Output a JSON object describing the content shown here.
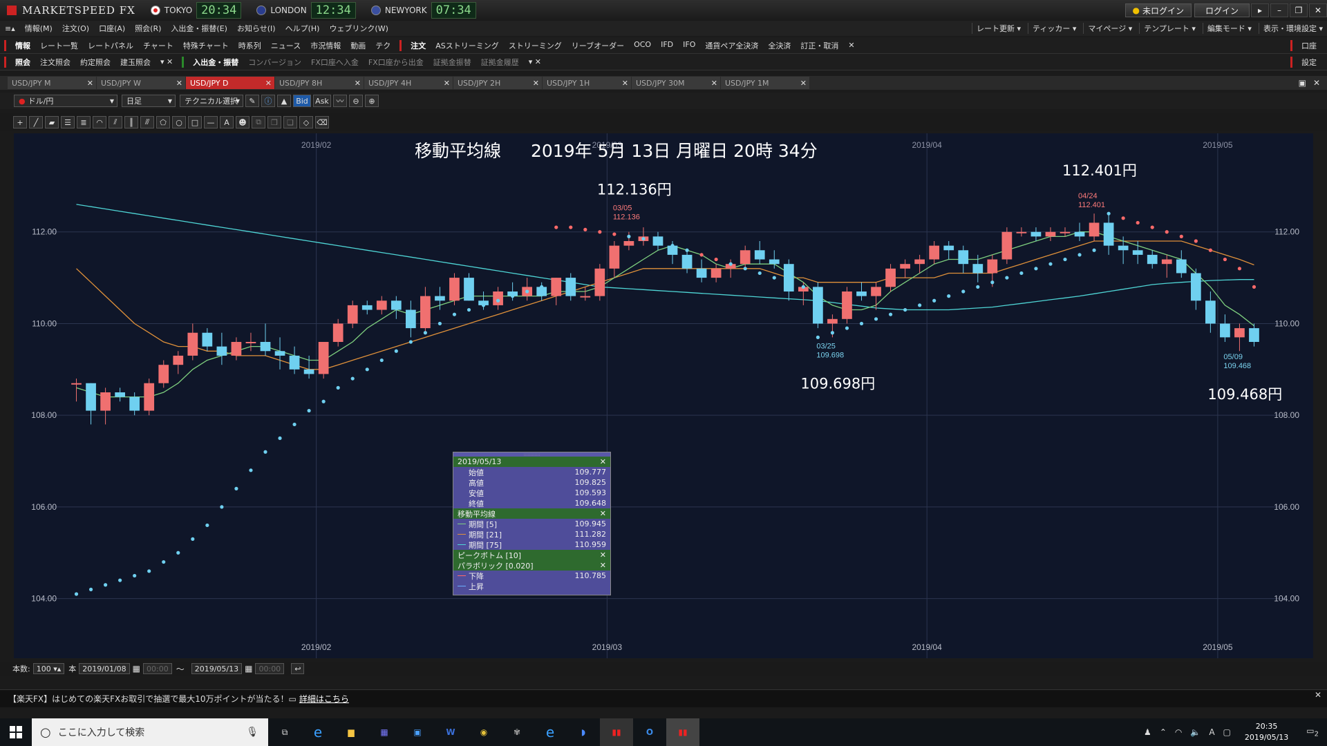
{
  "app": {
    "title": "MARKETSPEED FX"
  },
  "clocks": [
    {
      "city": "TOKYO",
      "time": "20:34",
      "flag": "#d22"
    },
    {
      "city": "LONDON",
      "time": "12:34",
      "flag": "#24a"
    },
    {
      "city": "NEWYORK",
      "time": "07:34",
      "flag": "#35a"
    }
  ],
  "titlebar": {
    "login_status": "未ログイン",
    "login": "ログイン"
  },
  "menu": [
    "情報(M)",
    "注文(O)",
    "口座(A)",
    "照会(R)",
    "入出金・振替(E)",
    "お知らせ(I)",
    "ヘルプ(H)",
    "ウェブリンク(W)"
  ],
  "menu_right": [
    "レート更新",
    "ティッカー",
    "マイページ",
    "テンプレート",
    "編集モード",
    "表示・環境設定"
  ],
  "toolbar1": {
    "left": [
      "情報",
      "レート一覧",
      "レートパネル",
      "チャート",
      "特殊チャート",
      "時系列",
      "ニュース",
      "市況情報",
      "動画",
      "テク"
    ],
    "right": [
      "注文",
      "ASストリーミング",
      "ストリーミング",
      "リーブオーダー",
      "OCO",
      "IFD",
      "IFO",
      "通貨ペア全決済",
      "全決済",
      "訂正・取消"
    ],
    "end": "口座"
  },
  "toolbar2": {
    "left": [
      "照会",
      "注文照会",
      "約定照会",
      "建玉照会"
    ],
    "right": [
      "入出金・振替",
      "コンバージョン",
      "FX口座へ入金",
      "FX口座から出金",
      "証拠金振替",
      "証拠金履歴"
    ],
    "end": "設定"
  },
  "tabs": [
    "USD/JPY M",
    "USD/JPY W",
    "USD/JPY D",
    "USD/JPY 8H",
    "USD/JPY 4H",
    "USD/JPY 2H",
    "USD/JPY 1H",
    "USD/JPY 30M",
    "USD/JPY 1M"
  ],
  "active_tab": 2,
  "controls": {
    "pair": "ドル/円",
    "timeframe": "日足",
    "technical": "テクニカル選択",
    "bid": "Bid",
    "ask": "Ask"
  },
  "chart_data": {
    "type": "candlestick",
    "title": "移動平均線",
    "datetime": "2019年 5月 13日 月曜日 20時 34分",
    "ylim": [
      103.0,
      114.0
    ],
    "yticks": [
      104.0,
      106.0,
      108.0,
      110.0,
      112.0
    ],
    "month_labels": [
      "2019/02",
      "2019/03",
      "2019/04",
      "2019/05"
    ],
    "callouts": [
      {
        "date": "03/05",
        "value": "112.136",
        "label": "112.136円",
        "kind": "high"
      },
      {
        "date": "03/25",
        "value": "109.698",
        "label": "109.698円",
        "kind": "low"
      },
      {
        "date": "04/24",
        "value": "112.401",
        "label": "112.401円",
        "kind": "high"
      },
      {
        "date": "05/09",
        "value": "109.468",
        "label": "109.468円",
        "kind": "low"
      }
    ],
    "ohlc": [
      [
        108.7,
        108.8,
        108.3,
        108.7
      ],
      [
        108.7,
        108.7,
        107.8,
        108.1
      ],
      [
        108.1,
        108.6,
        107.8,
        108.5
      ],
      [
        108.5,
        108.6,
        108.3,
        108.4
      ],
      [
        108.4,
        108.5,
        108.0,
        108.1
      ],
      [
        108.1,
        108.8,
        108.0,
        108.7
      ],
      [
        108.7,
        109.2,
        108.6,
        109.1
      ],
      [
        109.1,
        109.4,
        108.9,
        109.3
      ],
      [
        109.3,
        110.0,
        109.2,
        109.8
      ],
      [
        109.8,
        109.9,
        109.4,
        109.5
      ],
      [
        109.5,
        109.8,
        109.1,
        109.3
      ],
      [
        109.3,
        109.7,
        109.2,
        109.6
      ],
      [
        109.6,
        109.8,
        109.4,
        109.6
      ],
      [
        109.6,
        110.0,
        109.3,
        109.4
      ],
      [
        109.4,
        109.7,
        109.0,
        109.3
      ],
      [
        109.3,
        109.5,
        108.9,
        109.0
      ],
      [
        109.0,
        109.3,
        108.8,
        108.9
      ],
      [
        108.9,
        109.6,
        108.8,
        109.6
      ],
      [
        109.6,
        110.1,
        109.5,
        110.0
      ],
      [
        110.0,
        110.5,
        109.9,
        110.4
      ],
      [
        110.4,
        110.5,
        110.2,
        110.3
      ],
      [
        110.3,
        110.6,
        110.2,
        110.5
      ],
      [
        110.5,
        110.6,
        110.1,
        110.3
      ],
      [
        110.3,
        110.5,
        109.7,
        109.9
      ],
      [
        109.9,
        110.8,
        109.8,
        110.6
      ],
      [
        110.6,
        110.8,
        110.3,
        110.5
      ],
      [
        110.5,
        111.1,
        110.4,
        111.0
      ],
      [
        111.0,
        111.1,
        110.5,
        110.5
      ],
      [
        110.5,
        110.7,
        110.3,
        110.4
      ],
      [
        110.4,
        110.8,
        110.3,
        110.7
      ],
      [
        110.7,
        110.9,
        110.5,
        110.6
      ],
      [
        110.6,
        111.0,
        110.5,
        110.8
      ],
      [
        110.8,
        110.9,
        110.5,
        110.6
      ],
      [
        110.6,
        111.0,
        110.4,
        111.0
      ],
      [
        111.0,
        111.1,
        110.5,
        110.6
      ],
      [
        110.6,
        110.8,
        110.5,
        110.6
      ],
      [
        110.6,
        111.3,
        110.5,
        111.2
      ],
      [
        111.2,
        111.8,
        111.0,
        111.7
      ],
      [
        111.7,
        112.0,
        111.6,
        111.8
      ],
      [
        111.8,
        112.1,
        111.7,
        111.9
      ],
      [
        111.9,
        112.0,
        111.6,
        111.7
      ],
      [
        111.7,
        111.8,
        111.3,
        111.5
      ],
      [
        111.5,
        111.6,
        111.1,
        111.2
      ],
      [
        111.2,
        111.4,
        110.9,
        111.0
      ],
      [
        111.0,
        111.3,
        110.9,
        111.2
      ],
      [
        111.2,
        111.4,
        111.0,
        111.3
      ],
      [
        111.3,
        111.7,
        111.2,
        111.6
      ],
      [
        111.6,
        111.8,
        111.3,
        111.4
      ],
      [
        111.4,
        111.6,
        111.2,
        111.3
      ],
      [
        111.3,
        111.4,
        110.5,
        110.7
      ],
      [
        110.7,
        110.9,
        110.4,
        110.8
      ],
      [
        110.8,
        110.9,
        109.9,
        110.0
      ],
      [
        110.0,
        110.2,
        109.7,
        110.1
      ],
      [
        110.1,
        110.8,
        110.0,
        110.7
      ],
      [
        110.7,
        110.9,
        110.5,
        110.6
      ],
      [
        110.6,
        110.9,
        110.3,
        110.8
      ],
      [
        110.8,
        111.3,
        110.7,
        111.2
      ],
      [
        111.2,
        111.4,
        111.0,
        111.3
      ],
      [
        111.3,
        111.5,
        111.1,
        111.4
      ],
      [
        111.4,
        111.8,
        111.3,
        111.7
      ],
      [
        111.7,
        111.8,
        111.4,
        111.6
      ],
      [
        111.6,
        111.7,
        111.1,
        111.3
      ],
      [
        111.3,
        111.5,
        110.9,
        111.1
      ],
      [
        111.1,
        111.5,
        110.8,
        111.4
      ],
      [
        111.4,
        112.1,
        111.3,
        112.0
      ],
      [
        112.0,
        112.1,
        111.9,
        112.0
      ],
      [
        112.0,
        112.1,
        111.8,
        111.9
      ],
      [
        111.9,
        112.1,
        111.8,
        112.0
      ],
      [
        112.0,
        112.1,
        111.9,
        112.0
      ],
      [
        112.0,
        112.2,
        111.8,
        111.9
      ],
      [
        111.9,
        112.4,
        111.8,
        112.2
      ],
      [
        112.2,
        112.4,
        111.5,
        111.7
      ],
      [
        111.7,
        111.9,
        111.3,
        111.6
      ],
      [
        111.6,
        111.8,
        111.3,
        111.5
      ],
      [
        111.5,
        111.6,
        111.2,
        111.3
      ],
      [
        111.3,
        111.5,
        111.0,
        111.4
      ],
      [
        111.4,
        111.6,
        111.0,
        111.1
      ],
      [
        111.1,
        111.2,
        110.3,
        110.5
      ],
      [
        110.5,
        110.7,
        109.8,
        110.0
      ],
      [
        110.0,
        110.2,
        109.6,
        109.7
      ],
      [
        109.7,
        110.0,
        109.4,
        109.9
      ],
      [
        109.9,
        110.0,
        109.5,
        109.6
      ]
    ],
    "ma5": [
      108.6,
      108.5,
      108.4,
      108.4,
      108.4,
      108.4,
      108.5,
      108.7,
      109.0,
      109.2,
      109.3,
      109.4,
      109.5,
      109.5,
      109.4,
      109.3,
      109.2,
      109.2,
      109.4,
      109.6,
      109.9,
      110.1,
      110.3,
      110.2,
      110.3,
      110.4,
      110.5,
      110.6,
      110.6,
      110.6,
      110.6,
      110.6,
      110.6,
      110.7,
      110.7,
      110.7,
      110.8,
      111.0,
      111.2,
      111.4,
      111.6,
      111.7,
      111.6,
      111.5,
      111.3,
      111.2,
      111.3,
      111.3,
      111.3,
      111.1,
      110.9,
      110.6,
      110.4,
      110.3,
      110.3,
      110.4,
      110.7,
      110.9,
      111.1,
      111.3,
      111.4,
      111.4,
      111.4,
      111.5,
      111.6,
      111.7,
      111.8,
      111.9,
      111.9,
      112.0,
      112.0,
      111.9,
      111.8,
      111.7,
      111.6,
      111.5,
      111.4,
      111.1,
      110.8,
      110.4,
      110.2,
      109.95
    ],
    "ma21": [
      111.2,
      110.9,
      110.6,
      110.3,
      110.0,
      109.8,
      109.6,
      109.5,
      109.5,
      109.4,
      109.4,
      109.3,
      109.3,
      109.3,
      109.2,
      109.1,
      109.0,
      109.0,
      109.1,
      109.2,
      109.3,
      109.4,
      109.5,
      109.6,
      109.7,
      109.8,
      109.9,
      110.0,
      110.1,
      110.2,
      110.3,
      110.4,
      110.5,
      110.6,
      110.7,
      110.8,
      110.9,
      111.0,
      111.1,
      111.2,
      111.2,
      111.2,
      111.2,
      111.2,
      111.2,
      111.2,
      111.2,
      111.2,
      111.1,
      111.0,
      111.0,
      110.9,
      110.9,
      110.9,
      110.9,
      110.9,
      111.0,
      111.0,
      111.0,
      111.0,
      111.1,
      111.1,
      111.1,
      111.1,
      111.2,
      111.3,
      111.4,
      111.5,
      111.6,
      111.7,
      111.8,
      111.8,
      111.8,
      111.8,
      111.8,
      111.8,
      111.8,
      111.7,
      111.6,
      111.5,
      111.4,
      111.28
    ],
    "ma75": [
      112.6,
      112.55,
      112.5,
      112.45,
      112.4,
      112.35,
      112.3,
      112.25,
      112.2,
      112.15,
      112.1,
      112.05,
      112.0,
      111.95,
      111.9,
      111.85,
      111.8,
      111.75,
      111.7,
      111.65,
      111.6,
      111.55,
      111.5,
      111.45,
      111.4,
      111.35,
      111.3,
      111.25,
      111.2,
      111.15,
      111.1,
      111.05,
      111.0,
      110.95,
      110.9,
      110.85,
      110.8,
      110.78,
      110.76,
      110.74,
      110.72,
      110.7,
      110.68,
      110.66,
      110.64,
      110.62,
      110.6,
      110.58,
      110.56,
      110.54,
      110.52,
      110.5,
      110.46,
      110.42,
      110.38,
      110.34,
      110.32,
      110.3,
      110.3,
      110.3,
      110.3,
      110.32,
      110.34,
      110.36,
      110.4,
      110.44,
      110.48,
      110.52,
      110.56,
      110.6,
      110.65,
      110.7,
      110.75,
      110.8,
      110.85,
      110.88,
      110.9,
      110.92,
      110.94,
      110.95,
      110.96,
      110.96
    ],
    "sar": [
      104.1,
      104.2,
      104.3,
      104.4,
      104.5,
      104.6,
      104.8,
      105.0,
      105.3,
      105.6,
      106.0,
      106.4,
      106.8,
      107.2,
      107.5,
      107.8,
      108.1,
      108.3,
      108.6,
      108.8,
      109.0,
      109.2,
      109.4,
      109.6,
      109.8,
      110.0,
      110.2,
      110.3,
      110.4,
      110.5,
      110.6,
      110.7,
      110.8,
      112.1,
      112.1,
      112.05,
      112.0,
      111.95,
      111.9,
      111.85,
      111.8,
      111.7,
      111.6,
      111.5,
      111.4,
      111.3,
      111.2,
      111.1,
      111.0,
      110.9,
      110.8,
      109.7,
      109.8,
      109.9,
      110.0,
      110.1,
      110.2,
      110.3,
      110.4,
      110.5,
      110.6,
      110.7,
      110.8,
      110.9,
      111.0,
      111.1,
      111.2,
      111.3,
      111.4,
      111.5,
      111.6,
      112.4,
      112.3,
      112.2,
      112.1,
      112.0,
      111.9,
      111.8,
      111.6,
      111.4,
      111.2,
      110.8
    ]
  },
  "info_panel": {
    "date": "2019/05/13",
    "ohlc": [
      {
        "label": "始値",
        "value": "109.777"
      },
      {
        "label": "高値",
        "value": "109.825"
      },
      {
        "label": "安値",
        "value": "109.593"
      },
      {
        "label": "終値",
        "value": "109.648"
      }
    ],
    "ma_title": "移動平均線",
    "ma": [
      {
        "label": "期間 [5]",
        "value": "109.945",
        "color": "#7fd07f"
      },
      {
        "label": "期間 [21]",
        "value": "111.282",
        "color": "#e0913a"
      },
      {
        "label": "期間 [75]",
        "value": "110.959",
        "color": "#4fd6d6"
      }
    ],
    "peak": "ピークボトム [10]",
    "parabolic": "パラボリック [0.020]",
    "para": [
      {
        "label": "下降",
        "value": "110.785",
        "color": "#ff6a6a"
      },
      {
        "label": "上昇",
        "value": "",
        "color": "#6ab0ff"
      }
    ]
  },
  "bottom": {
    "count_label": "本数:",
    "count": "100",
    "unit": "本",
    "from": "2019/01/08",
    "from_time": "00:00",
    "tilde": "〜",
    "to": "2019/05/13",
    "to_time": "00:00"
  },
  "news": {
    "text": "【楽天FX】はじめての楽天FXお取引で抽選で最大10万ポイントが当たる！",
    "link": "詳細はこちら"
  },
  "taskbar": {
    "search": "ここに入力して検索",
    "time": "20:35",
    "date": "2019/05/13",
    "notif": "2"
  }
}
